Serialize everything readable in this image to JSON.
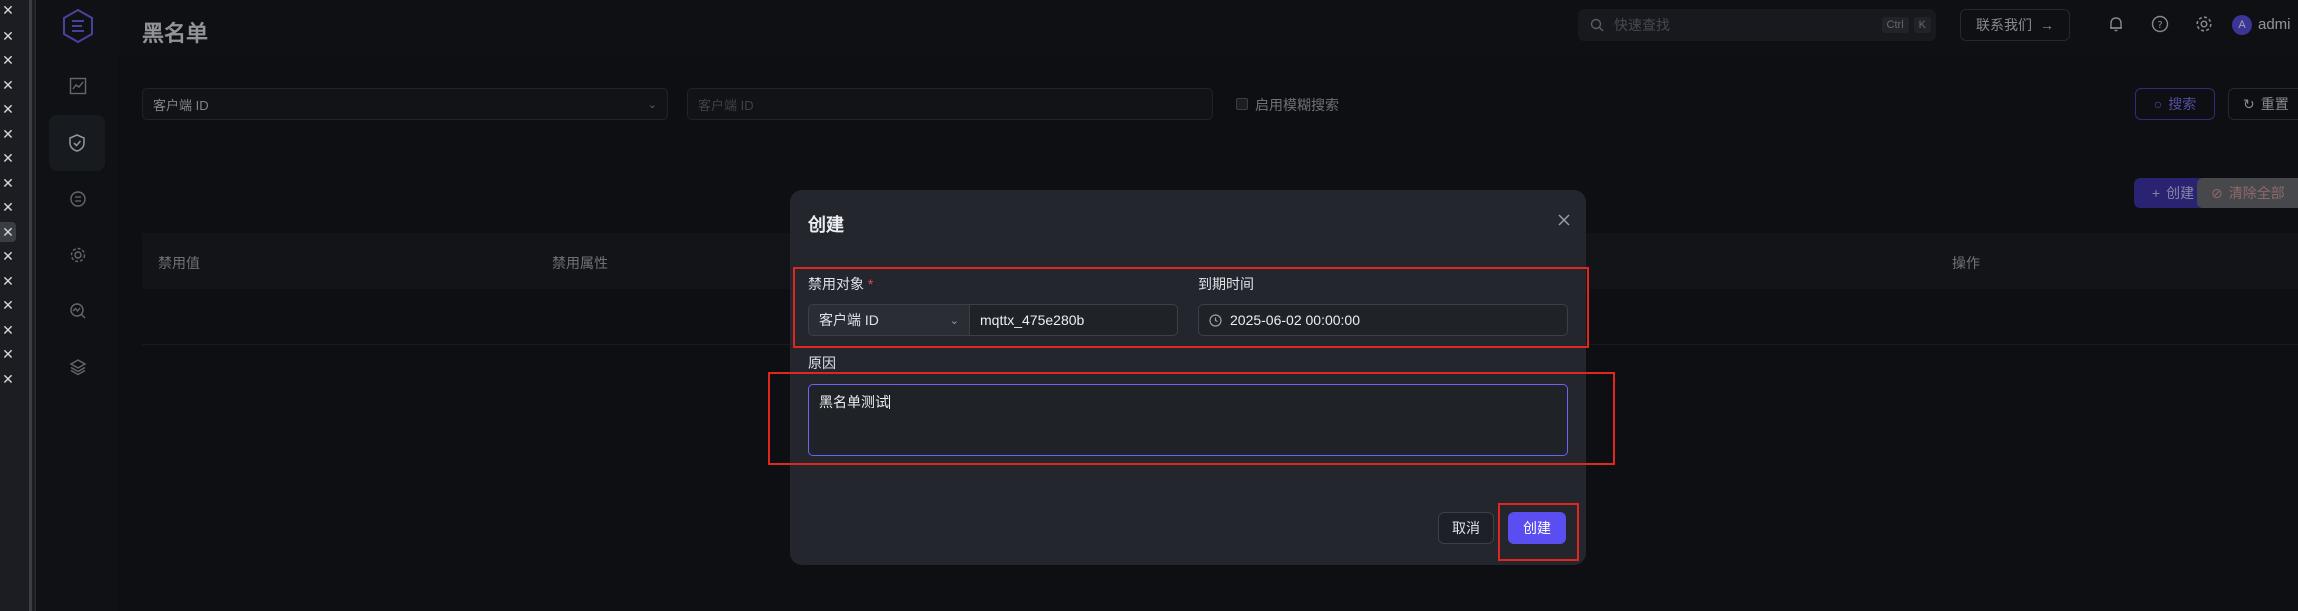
{
  "page": {
    "title": "黑名单",
    "search_placeholder": "快速查找",
    "shortcut_ctrl": "Ctrl",
    "shortcut_k": "K",
    "contact_label": "联系我们",
    "avatar_letter": "A",
    "user_name": "admi"
  },
  "filters": {
    "type_select": "客户端 ID",
    "value_placeholder": "客户端 ID",
    "fuzzy_label": "启用模糊搜索",
    "search_button": "搜索",
    "reset_button": "重置"
  },
  "actions": {
    "create_button": "创建",
    "clear_all_button": "清除全部"
  },
  "table": {
    "columns": [
      "禁用值",
      "禁用属性",
      "操作"
    ]
  },
  "modal": {
    "title": "创建",
    "target_label": "禁用对象",
    "required_mark": "*",
    "target_type": "客户端 ID",
    "target_value": "mqttx_475e280b",
    "expire_label": "到期时间",
    "expire_value": "2025-06-02 00:00:00",
    "reason_label": "原因",
    "reason_value": "黑名单测试",
    "cancel_button": "取消",
    "confirm_button": "创建"
  },
  "colors": {
    "accent": "#5b4ef0",
    "highlight": "#e0261f"
  }
}
